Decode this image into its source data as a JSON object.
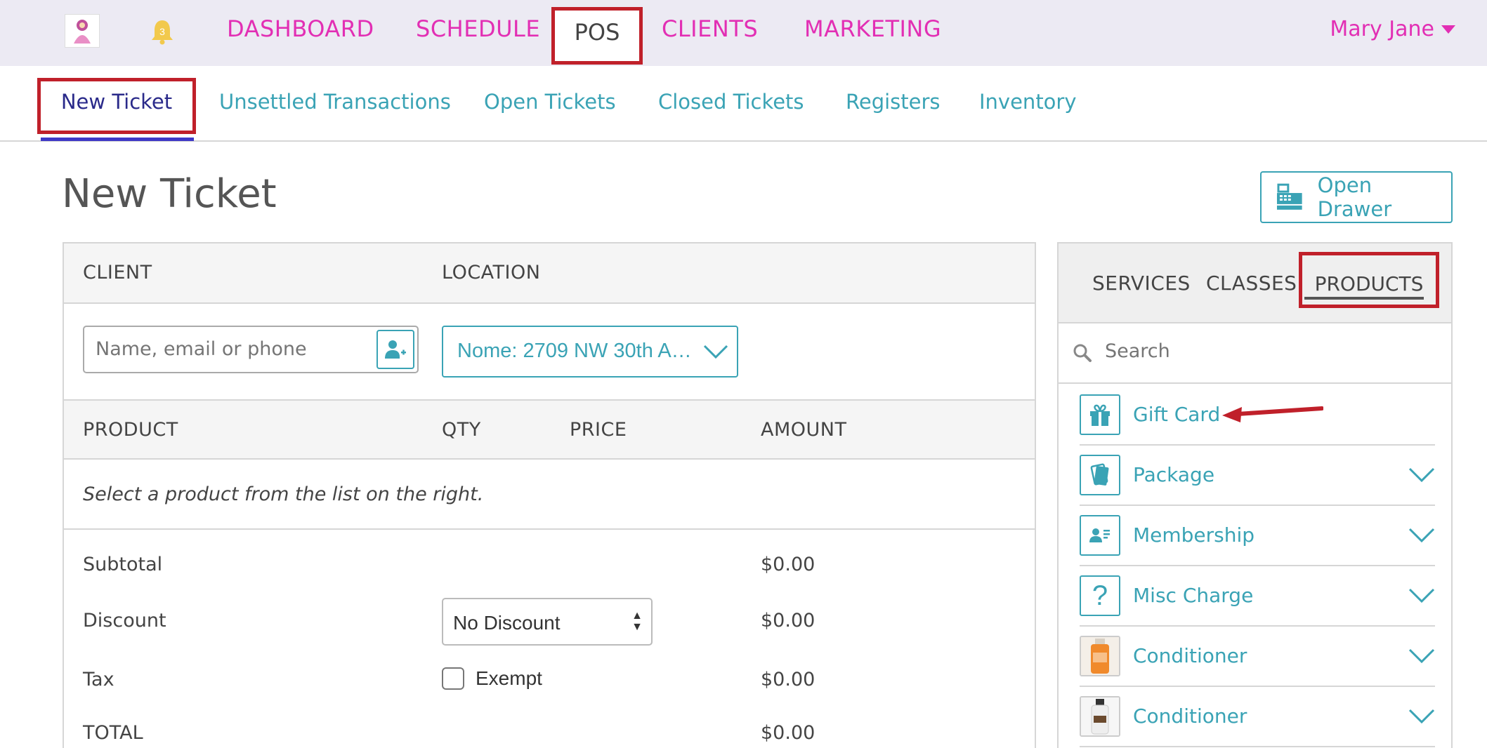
{
  "topnav": {
    "notification_count": "3",
    "items": [
      "DASHBOARD",
      "SCHEDULE",
      "POS",
      "CLIENTS",
      "MARKETING"
    ],
    "user_name": "Mary Jane"
  },
  "subnav": {
    "items": [
      "New Ticket",
      "Unsettled Transactions",
      "Open Tickets",
      "Closed Tickets",
      "Registers",
      "Inventory"
    ]
  },
  "page": {
    "title": "New Ticket",
    "open_drawer_label": "Open Drawer"
  },
  "ticket": {
    "client_header": "CLIENT",
    "location_header": "LOCATION",
    "client_placeholder": "Name, email or phone",
    "location_value": "Nome: 2709 NW 30th A…",
    "columns": [
      "PRODUCT",
      "QTY",
      "PRICE",
      "AMOUNT"
    ],
    "empty_message": "Select a product from the list on the right.",
    "subtotal_label": "Subtotal",
    "subtotal_value": "$0.00",
    "discount_label": "Discount",
    "discount_option": "No Discount",
    "discount_value": "$0.00",
    "tax_label": "Tax",
    "exempt_label": "Exempt",
    "tax_value": "$0.00",
    "total_label": "TOTAL",
    "total_value": "$0.00"
  },
  "products_panel": {
    "tabs": [
      "SERVICES",
      "CLASSES",
      "PRODUCTS"
    ],
    "search_placeholder": "Search",
    "items": [
      {
        "label": "Gift Card",
        "icon": "gift-icon"
      },
      {
        "label": "Package",
        "icon": "cards-icon"
      },
      {
        "label": "Membership",
        "icon": "id-card-icon"
      },
      {
        "label": "Misc Charge",
        "icon": "question-icon"
      },
      {
        "label": "Conditioner",
        "icon": "orange-bottle-image"
      },
      {
        "label": "Conditioner",
        "icon": "white-bottle-image"
      }
    ]
  },
  "colors": {
    "brand_pink": "#e22fb4",
    "teal": "#3aa3b5",
    "highlight_red": "#c0202a",
    "active_indigo": "#3f39c6"
  }
}
